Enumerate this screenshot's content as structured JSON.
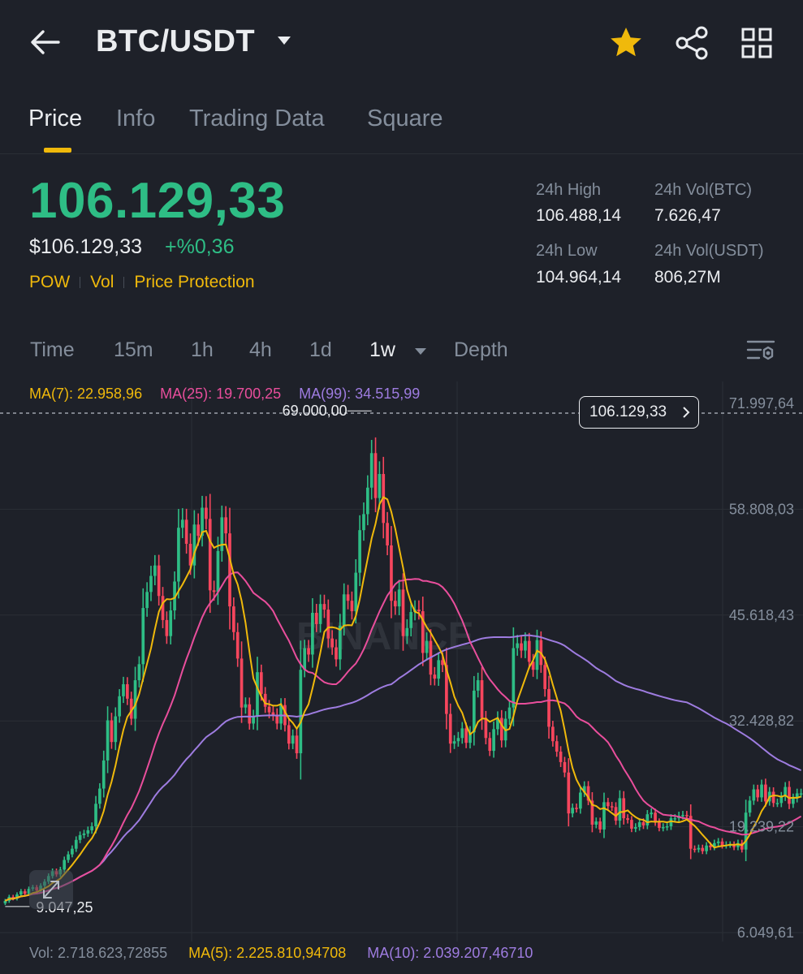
{
  "header": {
    "pair": "BTC/USDT"
  },
  "tabs": [
    "Price",
    "Info",
    "Trading Data",
    "Square"
  ],
  "price": {
    "last": "106.129,33",
    "usd": "$106.129,33",
    "change": "+%0,36",
    "tags": [
      "POW",
      "Vol",
      "Price Protection"
    ]
  },
  "stats": {
    "high_label": "24h High",
    "high_value": "106.488,14",
    "low_label": "24h Low",
    "low_value": "104.964,14",
    "vol_btc_label": "24h Vol(BTC)",
    "vol_btc_value": "7.626,47",
    "vol_usdt_label": "24h Vol(USDT)",
    "vol_usdt_value": "806,27M"
  },
  "timeframes": [
    "Time",
    "15m",
    "1h",
    "4h",
    "1d",
    "1w",
    "Depth"
  ],
  "selected_timeframe": "1w",
  "indicators": {
    "ma7": "MA(7): 22.958,96",
    "ma25": "MA(25): 19.700,25",
    "ma99": "MA(99): 34.515,99"
  },
  "volume": {
    "vol": "Vol: 2.718.623,72855",
    "ma5": "MA(5): 2.225.810,94708",
    "ma10": "MA(10): 2.039.207,46710"
  },
  "colors": {
    "up": "#2ebd85",
    "down": "#f6465d",
    "accent": "#f0b90b",
    "ma7": "#f0b90b",
    "ma25": "#e94e9c",
    "ma99": "#9e7ce0",
    "muted": "#848e9c"
  },
  "chart_data": {
    "type": "candlestick",
    "current_price_label": "106.129,33",
    "high_marker": "69.000,00",
    "low_marker": "9.047,25",
    "y_tick_labels": [
      "71.997,64",
      "58.808,03",
      "45.618,43",
      "32.428,82",
      "19.239,22",
      "6.049,61"
    ],
    "ylim": [
      6049.61,
      71997.64
    ],
    "closes": [
      10000,
      10500,
      10300,
      10800,
      11200,
      10900,
      11500,
      11700,
      11300,
      11900,
      12400,
      13100,
      13700,
      13300,
      13900,
      15100,
      15800,
      16500,
      17600,
      18200,
      18400,
      18800,
      19300,
      22100,
      24000,
      27500,
      32500,
      29800,
      33000,
      35500,
      37000,
      35200,
      32700,
      37500,
      39500,
      46500,
      48500,
      50500,
      51800,
      48000,
      45000,
      43000,
      46200,
      49800,
      56500,
      57500,
      54500,
      51800,
      56900,
      55500,
      59000,
      57600,
      48700,
      48500,
      53600,
      57800,
      55800,
      46700,
      43500,
      40200,
      34100,
      34500,
      32100,
      33000,
      38500,
      35800,
      34200,
      33500,
      33200,
      32100,
      34400,
      31900,
      29600,
      30600,
      28400,
      38800,
      41500,
      40700,
      45900,
      44500,
      47000,
      46300,
      42700,
      41600,
      40100,
      44300,
      48200,
      47400,
      46100,
      50900,
      56200,
      58200,
      61500,
      65800,
      60200,
      63200,
      57100,
      54300,
      47400,
      46700,
      48800,
      43000,
      44000,
      46000,
      46300,
      46100,
      40900,
      42400,
      38200,
      37700,
      40000,
      39400,
      33300,
      29600,
      29900,
      30300,
      31500,
      29700,
      31000,
      36200,
      37500,
      32800,
      30300,
      28700,
      31400,
      32800,
      30000,
      32700,
      34100,
      41500,
      42100,
      41200,
      42400,
      39800,
      38800,
      42500,
      39400,
      36400,
      31700,
      29900,
      28600,
      27300,
      26000,
      20900,
      21600,
      21500,
      23500,
      24300,
      22500,
      19500,
      19900,
      18900,
      22300,
      21800,
      21700,
      20000,
      22800,
      20300,
      20100,
      19000,
      19200,
      19800,
      19400,
      20800,
      21000,
      19800,
      19100,
      19200,
      19300,
      20300,
      20300,
      20600,
      20700,
      20600,
      16500,
      16400,
      16600,
      16200,
      16900,
      16700,
      17200,
      17400,
      16900,
      17000,
      17000,
      16700,
      17200,
      16400,
      21000,
      22500,
      23900,
      22900,
      24500,
      22400,
      23600,
      22200,
      22200,
      23000,
      24200,
      22100,
      22800,
      23400,
      23400
    ],
    "ma_series": [
      "MA(7)",
      "MA(25)",
      "MA(99)"
    ]
  }
}
